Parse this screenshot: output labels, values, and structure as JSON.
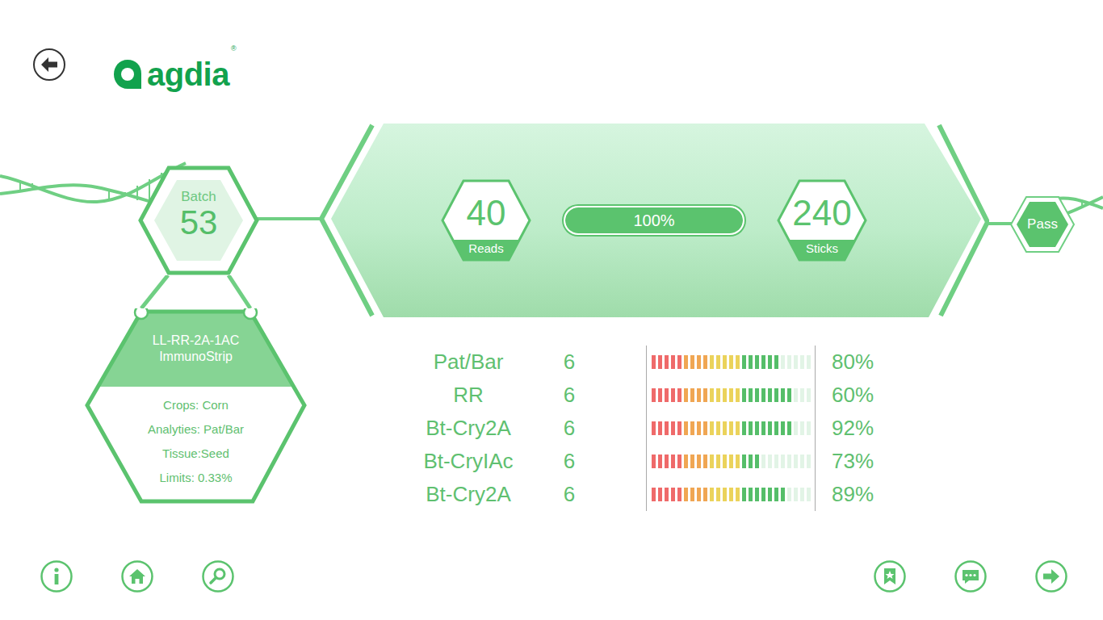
{
  "logo": {
    "text": "agdia",
    "mark": "®"
  },
  "batch": {
    "label": "Batch",
    "value": "53"
  },
  "product": {
    "title": "LL-RR-2A-1AC ImmunoStrip",
    "details": [
      "Crops: Corn",
      "Analyties: Pat/Bar",
      "Tissue:Seed",
      "Limits: 0.33%"
    ]
  },
  "summary": {
    "reads": {
      "value": "40",
      "label": "Reads"
    },
    "progress": {
      "level": 1,
      "reading": "100%"
    },
    "sticks": {
      "value": "240",
      "label": "Sticks"
    }
  },
  "result": {
    "label": "Pass"
  },
  "analytes": [
    {
      "name": "Pat/Bar",
      "count": "6",
      "level": 0.8,
      "reading": "80%"
    },
    {
      "name": "RR",
      "count": "6",
      "level": 0.88,
      "reading": "60%"
    },
    {
      "name": "Bt-Cry2A",
      "count": "6",
      "level": 0.88,
      "reading": "92%"
    },
    {
      "name": "Bt-CryIAc",
      "count": "6",
      "level": 0.68,
      "reading": "73%"
    },
    {
      "name": "Bt-Cry2A",
      "count": "6",
      "level": 0.84,
      "reading": "89%"
    }
  ]
}
